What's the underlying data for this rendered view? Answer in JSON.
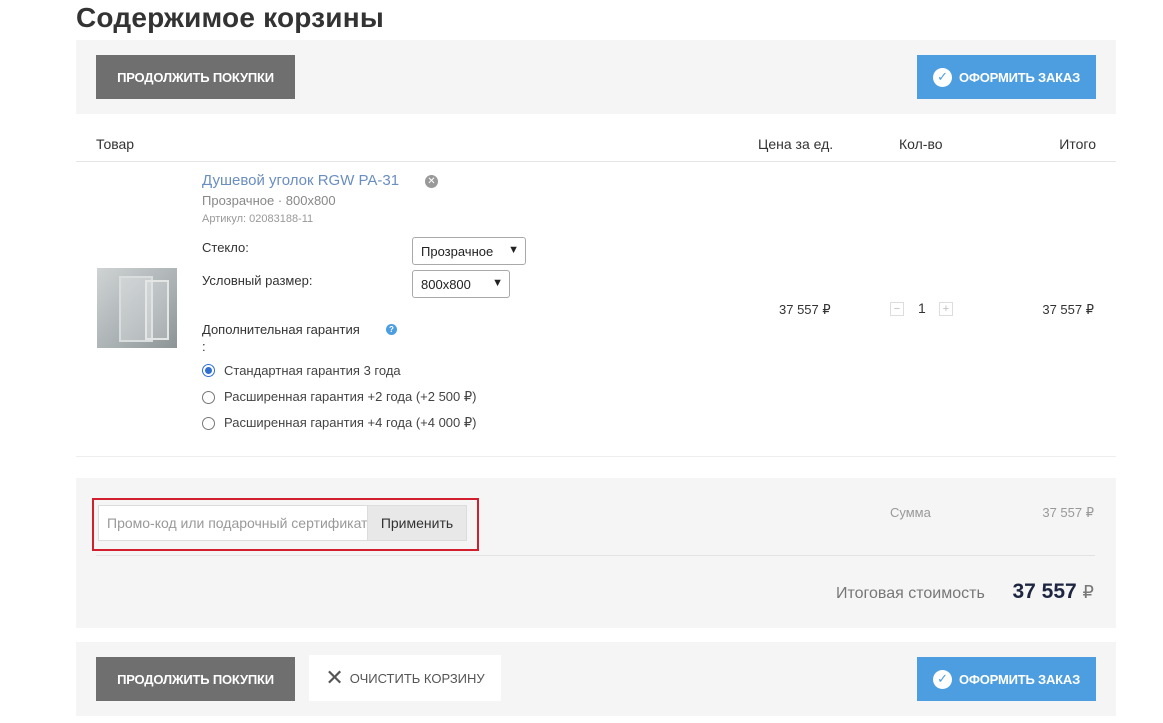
{
  "page": {
    "title": "Содержимое корзины"
  },
  "toolbar": {
    "continue_label": "ПРОДОЛЖИТЬ ПОКУПКИ",
    "checkout_label": "ОФОРМИТЬ ЗАКАЗ",
    "clear_label": "ОЧИСТИТЬ КОРЗИНУ"
  },
  "table": {
    "headers": {
      "product": "Товар",
      "unit_price": "Цена за ед.",
      "qty": "Кол-во",
      "total": "Итого"
    }
  },
  "item": {
    "name": "Душевой уголок RGW PA-31",
    "variant": "Прозрачное · 800x800",
    "sku": "Артикул: 02083188-11",
    "options": {
      "glass_label": "Стекло:",
      "glass_value": "Прозрачное",
      "size_label": "Условный размер:",
      "size_value": "800x800",
      "warranty_label": "Дополнительная гарантия",
      "warranty_colon": ":",
      "warranty_choices": [
        "Стандартная гарантия 3 года",
        "Расширенная гарантия +2 года (+2 500 ₽)",
        "Расширенная гарантия +4 года (+4 000 ₽)"
      ],
      "warranty_selected_index": 0
    },
    "unit_price": "37 557 ₽",
    "quantity": "1",
    "qty_minus": "−",
    "qty_plus": "+",
    "line_total": "37 557 ₽"
  },
  "summary": {
    "promo_placeholder": "Промо-код или подарочный сертификат",
    "apply_label": "Применить",
    "sum_label": "Сумма",
    "sum_value": "37 557 ₽",
    "total_label": "Итоговая стоимость",
    "total_value": "37 557",
    "total_currency": "₽"
  },
  "icons": {
    "checkout": "check-circle-icon",
    "remove": "close-circle-icon",
    "help": "question-circle-icon",
    "clear": "close-icon"
  },
  "colors": {
    "accent": "#4c9ee0",
    "dark_button": "#6f6f6f",
    "link": "#6a8ec0",
    "highlight_border": "#d11f2d"
  }
}
